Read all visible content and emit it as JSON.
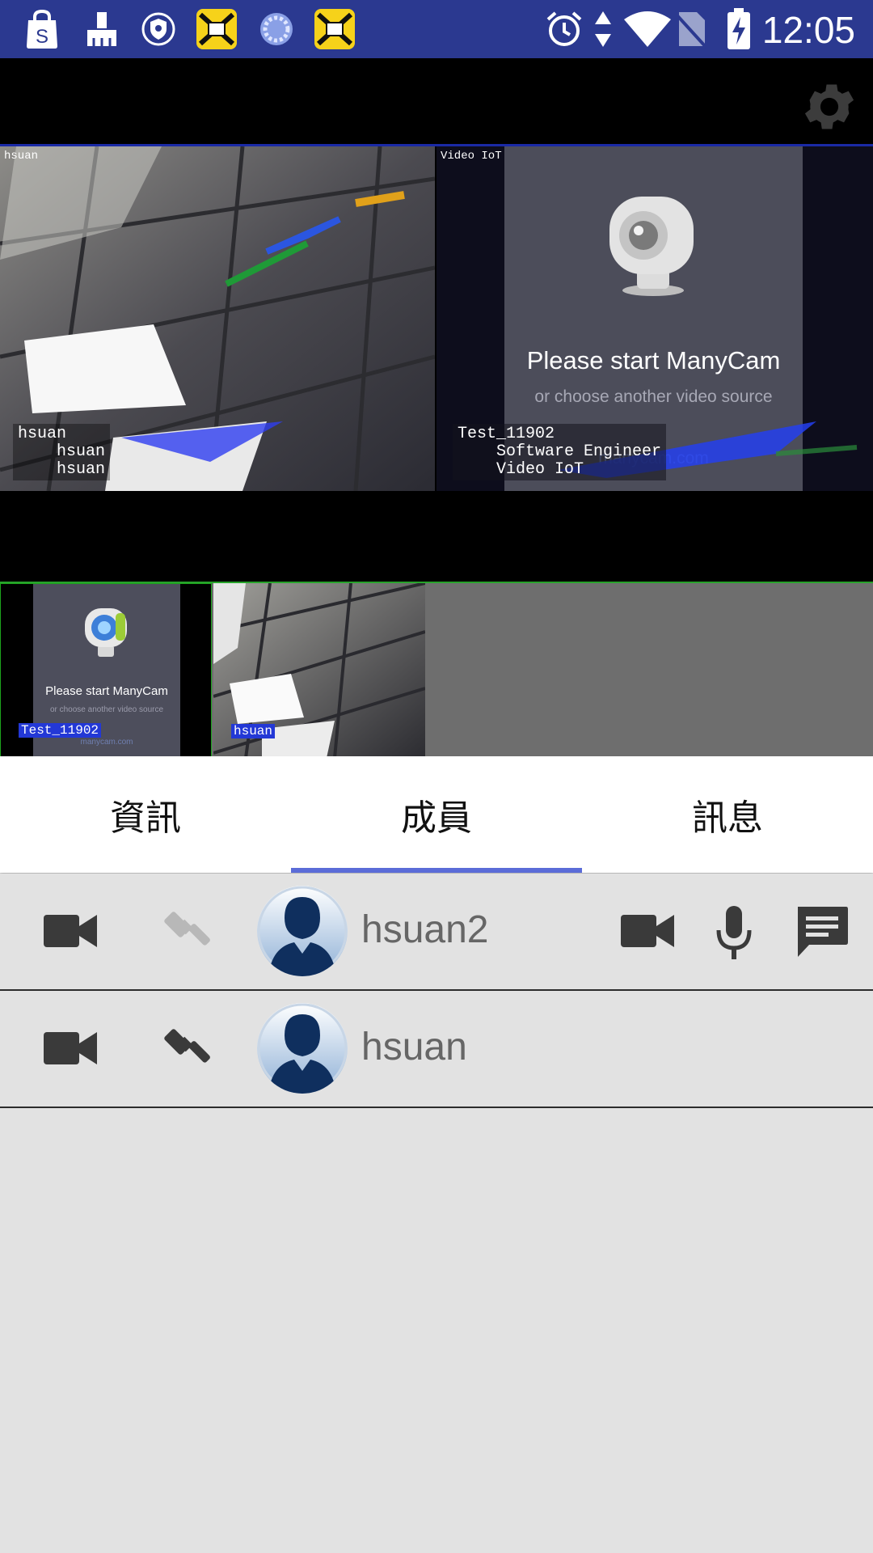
{
  "status_bar": {
    "time": "12:05",
    "left_icons": [
      "shopping-bag-icon",
      "clean-brush-icon",
      "vpn-shield-icon",
      "app-news-icon",
      "loading-icon",
      "app-news-icon"
    ],
    "right_icons": [
      "alarm-icon",
      "data-arrows-icon",
      "wifi-icon",
      "no-sim-icon",
      "battery-charging-icon"
    ],
    "background": "#2b3990"
  },
  "toolbar": {
    "settings_icon": "gear-icon"
  },
  "main_video": {
    "left_tile": {
      "label": "hsuan",
      "overlay_lines": [
        "hsuan",
        "    hsuan",
        "    hsuan"
      ]
    },
    "right_tile": {
      "label": "Video IoT",
      "placeholder_title": "Please start ManyCam",
      "placeholder_subtitle": "or choose another video source",
      "brand": "manycam.com",
      "overlay_lines": [
        "Test_11902",
        "    Software Engineer",
        "    Video IoT"
      ]
    }
  },
  "thumbnails": [
    {
      "tag": "Test_11902",
      "title": "Please start ManyCam",
      "subtitle": "or choose another video source",
      "brand": "manycam.com"
    },
    {
      "tag": "hsuan"
    }
  ],
  "tabs": [
    {
      "label": "資訊",
      "selected": false
    },
    {
      "label": "成員",
      "selected": true
    },
    {
      "label": "訊息",
      "selected": false
    }
  ],
  "members": [
    {
      "name": "hsuan2",
      "host": false,
      "icons": [
        "videocam-icon",
        "gavel-icon",
        "avatar",
        "videocam-icon",
        "mic-icon",
        "chat-icon"
      ]
    },
    {
      "name": "hsuan",
      "host": true,
      "icons": [
        "videocam-icon",
        "gavel-icon",
        "avatar"
      ]
    }
  ],
  "colors": {
    "accent": "#5b6cd8",
    "icon_dark": "#3a3a3a",
    "icon_light": "#b8b8b8",
    "list_background": "#e2e2e2",
    "name_text": "#666666"
  }
}
